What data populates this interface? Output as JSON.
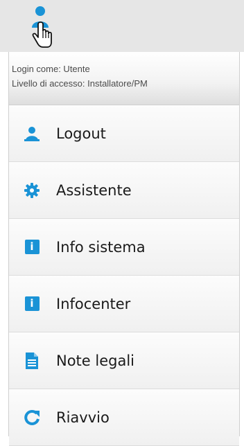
{
  "header": {
    "login_line": "Login come: Utente",
    "access_line": "Livello di accesso: Installatore/PM"
  },
  "menu": {
    "items": [
      {
        "label": "Logout",
        "icon": "user-icon"
      },
      {
        "label": "Assistente",
        "icon": "gear-icon"
      },
      {
        "label": "Info sistema",
        "icon": "info-icon"
      },
      {
        "label": "Infocenter",
        "icon": "info-icon"
      },
      {
        "label": "Note legali",
        "icon": "document-icon"
      },
      {
        "label": "Riavvio",
        "icon": "refresh-icon"
      }
    ]
  },
  "colors": {
    "accent": "#1a93d6",
    "topbar": "#e6e6e6",
    "text": "#1a1a1a"
  }
}
